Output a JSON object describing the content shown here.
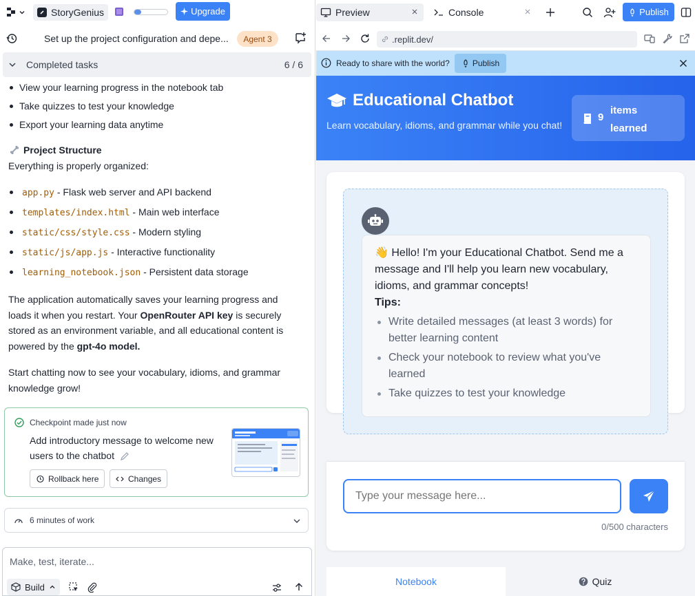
{
  "left": {
    "project_name": "StoryGenius",
    "usage_progress": 0.2,
    "upgrade_label": "Upgrade",
    "agent_title": "Set up the project configuration and depe...",
    "agent_badge": "Agent 3",
    "tasks": {
      "label": "Completed tasks",
      "count": "6 / 6"
    },
    "bullets": [
      "View your learning progress in the notebook tab",
      "Take quizzes to test your knowledge",
      "Export your learning data anytime"
    ],
    "structure_heading": "Project Structure",
    "structure_sub": "Everything is properly organized:",
    "files": [
      {
        "name": "app.py",
        "desc": " - Flask web server and API backend"
      },
      {
        "name": "templates/index.html",
        "desc": " - Main web interface"
      },
      {
        "name": "static/css/style.css",
        "desc": " - Modern styling"
      },
      {
        "name": "static/js/app.js",
        "desc": " - Interactive functionality"
      },
      {
        "name": "learning_notebook.json",
        "desc": " - Persistent data storage"
      }
    ],
    "para1": {
      "a": "The application automatically saves your learning progress and loads it when you restart. Your ",
      "b": "OpenRouter API key",
      "c": " is securely stored as an environment variable, and all educational content is powered by the ",
      "d": "gpt-4o model."
    },
    "para2": "Start chatting now to see your vocabulary, idioms, and grammar knowledge grow!",
    "checkpoint": {
      "head": "Checkpoint made just now",
      "message": "Add introductory message to welcome new users to the chatbot",
      "rollback": "Rollback here",
      "changes": "Changes"
    },
    "work_label": "6 minutes of work",
    "composer_placeholder": "Make, test, iterate...",
    "build_label": "Build"
  },
  "right": {
    "tabs": [
      {
        "label": "Preview"
      },
      {
        "label": "Console"
      }
    ],
    "publish_label": "Publish",
    "url": ".replit.dev/",
    "notice": {
      "text": "Ready to share with the world?",
      "button": "Publish"
    },
    "hero": {
      "title": "Educational Chatbot",
      "subtitle": "Learn vocabulary, idioms, and grammar while you chat!",
      "stat_value": "9",
      "stat_label": "items learned"
    },
    "bot_message": {
      "intro": "👋 Hello! I'm your Educational Chatbot. Send me a message and I'll help you learn new vocabulary, idioms, and grammar concepts!",
      "tips_label": "Tips:",
      "tips": [
        "Write detailed messages (at least 3 words) for better learning content",
        "Check your notebook to review what you've learned",
        "Take quizzes to test your knowledge"
      ]
    },
    "input_placeholder": "Type your message here...",
    "char_count": "0/500 characters",
    "bottom_tabs": [
      {
        "label": "Notebook"
      },
      {
        "label": "Quiz"
      }
    ]
  },
  "colors": {
    "accent": "#3b82f6",
    "hero_start": "#3b82f6",
    "hero_end": "#2563eb",
    "notice_bg": "#bfe1fb",
    "badge_bg": "#fde2c8",
    "checkpoint_border": "#8cc9a4"
  }
}
